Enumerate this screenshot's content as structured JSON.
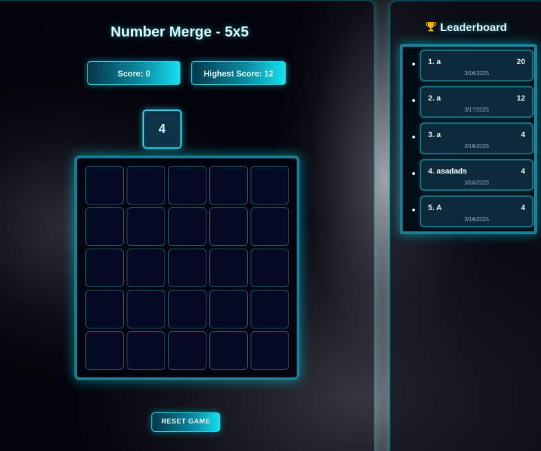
{
  "game": {
    "title": "Number Merge - 5x5",
    "score_label": "Score: 0",
    "highest_score_label": "Highest Score: 12",
    "next_tile_value": "4",
    "board_size": 5,
    "reset_label": "RESET GAME"
  },
  "leaderboard": {
    "title": "Leaderboard",
    "icon": "trophy-icon",
    "entries": [
      {
        "name": "1. a",
        "score": "20",
        "date": "3/16/2025"
      },
      {
        "name": "2. a",
        "score": "12",
        "date": "3/17/2025"
      },
      {
        "name": "3. a",
        "score": "4",
        "date": "3/16/2025"
      },
      {
        "name": "4. asadads",
        "score": "4",
        "date": "3/16/2025"
      },
      {
        "name": "5. A",
        "score": "4",
        "date": "3/16/2025"
      }
    ]
  },
  "colors": {
    "accent": "#00e5ff",
    "panel_border": "#1a7f94",
    "background": "#050509"
  }
}
